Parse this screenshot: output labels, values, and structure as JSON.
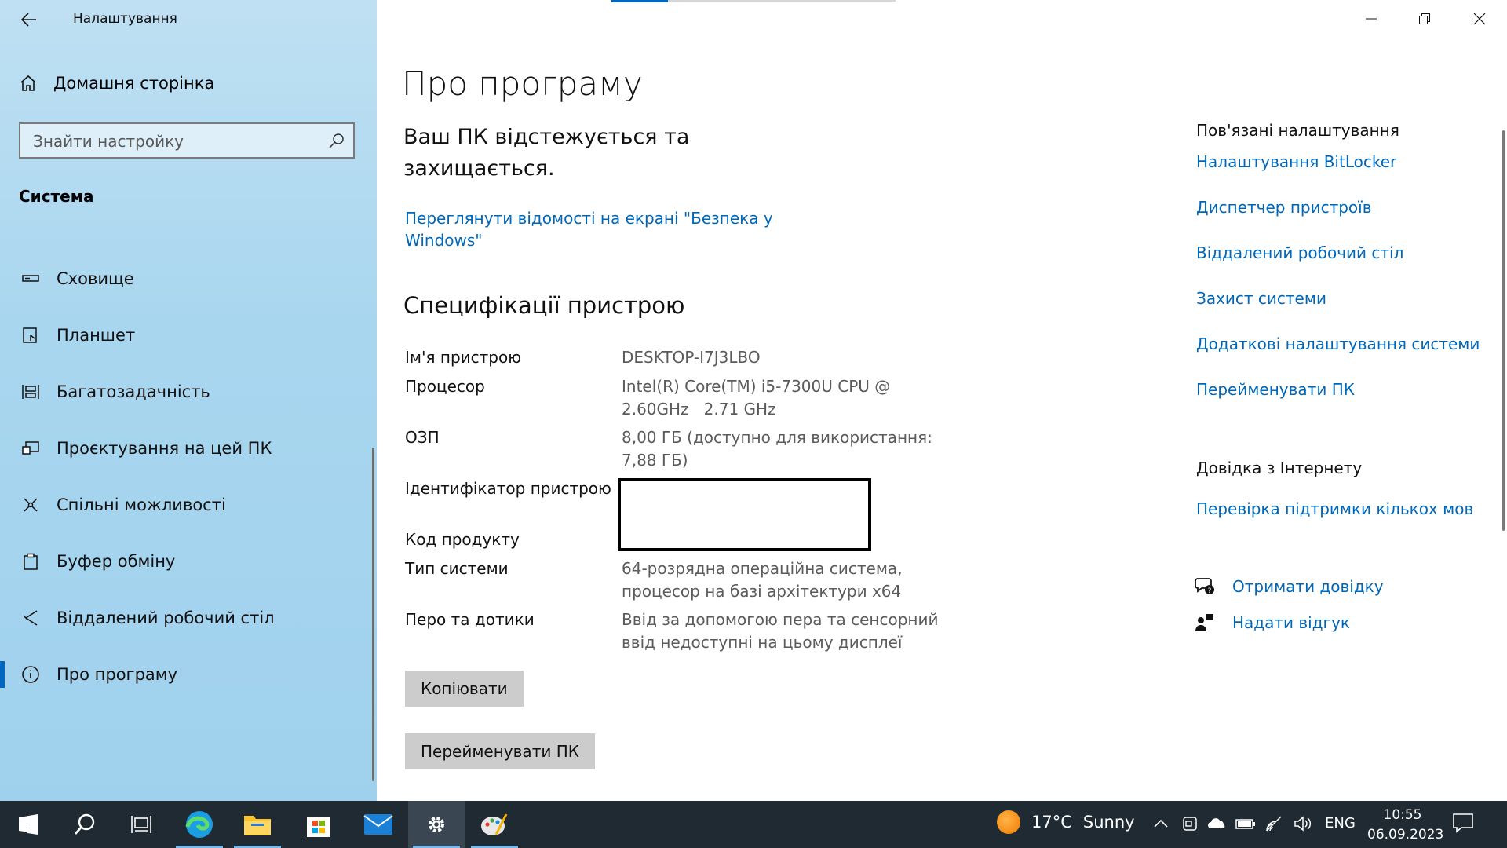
{
  "window": {
    "title": "Налаштування"
  },
  "sidebar": {
    "home_label": "Домашня сторінка",
    "search_placeholder": "Знайти настройку",
    "section_title": "Система",
    "items": [
      {
        "label": "Сховище",
        "icon": "storage-icon"
      },
      {
        "label": "Планшет",
        "icon": "tablet-icon"
      },
      {
        "label": "Багатозадачність",
        "icon": "multitasking-icon"
      },
      {
        "label": "Проєктування на цей ПК",
        "icon": "projecting-icon"
      },
      {
        "label": "Спільні можливості",
        "icon": "shared-experiences-icon"
      },
      {
        "label": "Буфер обміну",
        "icon": "clipboard-icon"
      },
      {
        "label": "Віддалений робочий стіл",
        "icon": "remote-desktop-icon"
      },
      {
        "label": "Про програму",
        "icon": "info-icon",
        "active": true
      }
    ]
  },
  "main": {
    "title": "Про програму",
    "protection_text": "Ваш ПК відстежується та захищається.",
    "security_link": "Переглянути відомості на екрані \"Безпека у Windows\"",
    "specs_title": "Специфікації пристрою",
    "specs": [
      {
        "key": "Ім'я пристрою",
        "value": "DESKTOP-I7J3LBO"
      },
      {
        "key": "Процесор",
        "value": "Intel(R) Core(TM) i5-7300U CPU @ 2.60GHz   2.71 GHz"
      },
      {
        "key": "ОЗП",
        "value": "8,00 ГБ (доступно для використання: 7,88 ГБ)"
      },
      {
        "key": "Ідентифікатор пристрою",
        "value": ""
      },
      {
        "key": "Код продукту",
        "value": ""
      },
      {
        "key": "Тип системи",
        "value": "64-розрядна операційна система, процесор на базі архітектури x64"
      },
      {
        "key": "Перо та дотики",
        "value": "Ввід за допомогою пера та сенсорний ввід недоступні на цьому дисплеї"
      }
    ],
    "copy_button": "Копіювати",
    "rename_button": "Перейменувати ПК"
  },
  "related": {
    "title": "Пов'язані налаштування",
    "links": [
      "Налаштування BitLocker",
      "Диспетчер пристроїв",
      "Віддалений робочий стіл",
      "Захист системи",
      "Додаткові налаштування системи",
      "Перейменувати ПК"
    ],
    "web_help_title": "Довідка з Інтернету",
    "web_help_links": [
      "Перевірка підтримки кількох мов"
    ],
    "get_help": "Отримати довідку",
    "give_feedback": "Надати відгук"
  },
  "taskbar": {
    "weather_temp": "17°C",
    "weather_text": "Sunny",
    "language": "ENG",
    "time": "10:55",
    "date": "06.09.2023",
    "apps": [
      "start-icon",
      "search-icon",
      "task-view-icon",
      "edge-icon",
      "file-explorer-icon",
      "store-icon",
      "mail-icon",
      "settings-icon",
      "paint-icon"
    ]
  },
  "colors": {
    "accent": "#0067c0",
    "link": "#0067b8",
    "taskbar": "#1f2a33",
    "sidebar": "#a9d6ef"
  }
}
